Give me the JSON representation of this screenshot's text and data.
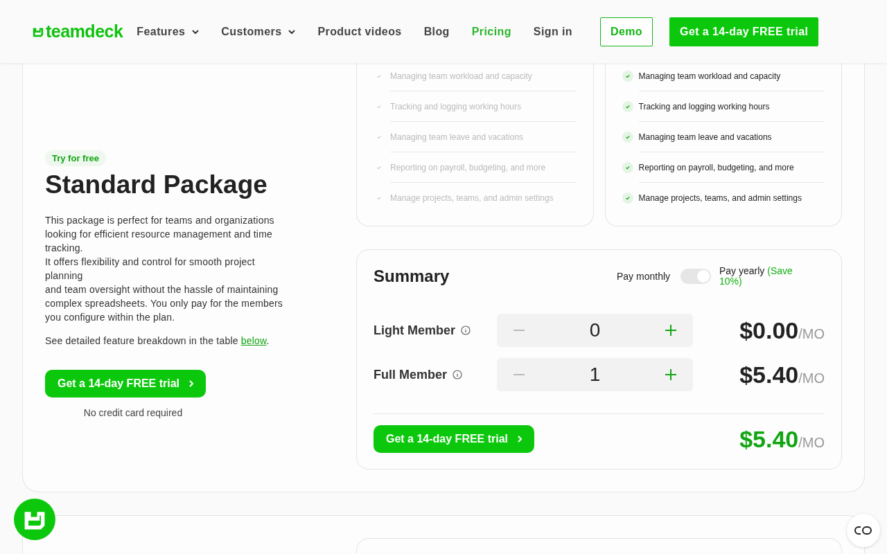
{
  "header": {
    "logo": "teamdeck",
    "nav": [
      {
        "label": "Features",
        "dropdown": true,
        "selected": false
      },
      {
        "label": "Customers",
        "dropdown": true,
        "selected": false
      },
      {
        "label": "Product videos",
        "dropdown": false,
        "selected": false
      },
      {
        "label": "Blog",
        "dropdown": false,
        "selected": false
      },
      {
        "label": "Pricing",
        "dropdown": false,
        "selected": true
      },
      {
        "label": "Sign in",
        "dropdown": false,
        "selected": false
      }
    ],
    "demo_button": "Demo",
    "trial_button": "Get a 14-day FREE trial"
  },
  "package": {
    "badge": "Try for free",
    "title": "Standard Package",
    "description": "This package is perfect for teams and organizations looking for efficient resource management and time tracking.\nIt offers flexibility and control for smooth project planning\nand team oversight without the hassle of maintaining complex spreadsheets. You only pay for the members you configure within the plan.",
    "breakdown_text": "See detailed feature breakdown in the table ",
    "breakdown_link": "below",
    "breakdown_end": ".",
    "cta": "Get a 14-day FREE trial",
    "cta_note": "No credit card required"
  },
  "feature_cards": [
    {
      "items": [
        {
          "label": "Managing team workload and capacity",
          "included": false
        },
        {
          "label": "Tracking and logging working hours",
          "included": false
        },
        {
          "label": "Managing team leave and vacations",
          "included": false
        },
        {
          "label": "Reporting on payroll, budgeting, and more",
          "included": false
        },
        {
          "label": "Manage projects, teams, and admin settings",
          "included": false
        }
      ]
    },
    {
      "items": [
        {
          "label": "Managing team workload and capacity",
          "included": true
        },
        {
          "label": "Tracking and logging working hours",
          "included": true
        },
        {
          "label": "Managing team leave and vacations",
          "included": true
        },
        {
          "label": "Reporting on payroll, budgeting, and more",
          "included": true
        },
        {
          "label": "Manage projects, teams, and admin settings",
          "included": true
        }
      ]
    }
  ],
  "summary": {
    "title": "Summary",
    "monthly_label": "Pay monthly",
    "yearly_label": "Pay yearly",
    "yearly_note": "(Save 10%)",
    "yearly_on": true,
    "members": [
      {
        "label": "Light Member",
        "count": "0",
        "price": "$0.00",
        "unit": "/MO"
      },
      {
        "label": "Full Member",
        "count": "1",
        "price": "$5.40",
        "unit": "/MO"
      }
    ],
    "cta": "Get a 14-day FREE trial",
    "total": "$5.40",
    "total_unit": "/MO"
  }
}
